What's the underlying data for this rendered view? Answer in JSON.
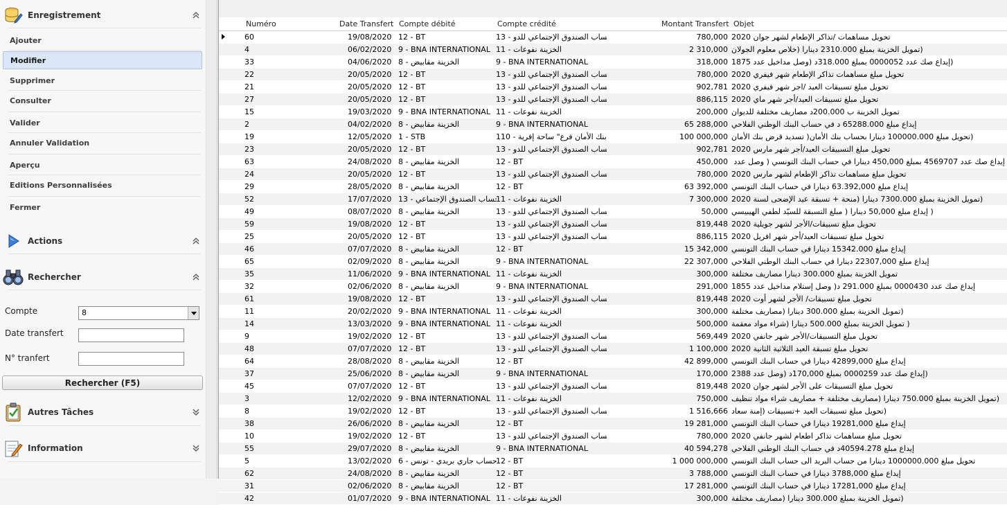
{
  "sidebar": {
    "enregistrement": {
      "title": "Enregistrement",
      "items": [
        "Ajouter",
        "Modifier",
        "Supprimer",
        "Consulter",
        "Valider",
        "Annuler Validation",
        "Aperçu",
        "Editions Personnalisées",
        "Fermer"
      ],
      "active": "Modifier"
    },
    "actions": {
      "title": "Actions"
    },
    "rechercher": {
      "title": "Rechercher",
      "compte_label": "Compte",
      "compte_value": "8",
      "date_label": "Date transfert",
      "date_value": "",
      "numero_label": "N° tranfert",
      "numero_value": "",
      "button_label": "Rechercher (F5)"
    },
    "autres_taches": {
      "title": "Autres Tâches"
    },
    "information": {
      "title": "Information"
    }
  },
  "grid": {
    "headers": {
      "numero": "Numéro",
      "date": "Date Transfert",
      "debite": "Compte débité",
      "credite": "Compte crédité",
      "montant": "Montant Transfert",
      "objet": "Objet"
    },
    "rows": [
      {
        "numero": "60",
        "date": "19/08/2020",
        "debite": "12 - BT",
        "credite": "13 - حساب الصندوق الإجتماعي للدو",
        "montant": "780,000",
        "objet": "تحويل مساهمات /تذاكر الإطعام لشهر جوان 2020"
      },
      {
        "numero": "4",
        "date": "06/02/2020",
        "debite": "9 - BNA INTERNATIONAL",
        "credite": "11 - الخزينة نفوعات",
        "montant": "2 310,000",
        "objet": "(تمويل الخزينة بمبلغ 2310.000 دينارا (خلاص معلوم الجولان"
      },
      {
        "numero": "33",
        "date": "04/06/2020",
        "debite": "8 - الخزينة مقابيض",
        "credite": "9 - BNA INTERNATIONAL",
        "montant": "318,000",
        "objet": "(إيداع صك عدد 0000052 بمبلغ 318.000د (وصل مداخيل عدد 1875"
      },
      {
        "numero": "22",
        "date": "20/05/2020",
        "debite": "12 - BT",
        "credite": "13 - حساب الصندوق الإجتماعي للدو",
        "montant": "780,000",
        "objet": "تحويل مبلغ مساهمات تذاكر الإطعام شهر فيفري 2020"
      },
      {
        "numero": "21",
        "date": "20/05/2020",
        "debite": "12 - BT",
        "credite": "13 - حساب الصندوق الإجتماعي للدو",
        "montant": "902,781",
        "objet": "تحويل مبلغ تسبيقات العيد /اجر شهر فيفري 2020"
      },
      {
        "numero": "27",
        "date": "20/05/2020",
        "debite": "12 - BT",
        "credite": "13 - حساب الصندوق الإجتماعي للدو",
        "montant": "886,115",
        "objet": "تحويل مبلغ تسبيقات العيد/أجر شهر ماي 2020"
      },
      {
        "numero": "15",
        "date": "19/03/2020",
        "debite": "9 - BNA INTERNATIONAL",
        "credite": "11 - الخزينة نفوعات",
        "montant": "200,000",
        "objet": "تمويل الخزينة ب 200.000د مصاريف مختلفة للديوان"
      },
      {
        "numero": "2",
        "date": "04/02/2020",
        "debite": "8 - الخزينة مقابيض",
        "credite": "9 - BNA INTERNATIONAL",
        "montant": "65 288,000",
        "objet": "إيداع مبلغ 65288.000 د في حساب البنك الوطني الفلاحي"
      },
      {
        "numero": "19",
        "date": "12/05/2020",
        "debite": "1 - STB",
        "credite": "110 - بنك الأمان فرع\" ساحة إفرية",
        "montant": "100 000,000",
        "objet": "(تحويل مبلغ 100000.000 دينارا بحساب بنك الأمان( تسديد قرض بنك الأمان"
      },
      {
        "numero": "23",
        "date": "20/05/2020",
        "debite": "12 - BT",
        "credite": "13 - حساب الصندوق الإجتماعي للدو",
        "montant": "902,781",
        "objet": "تحويل مبلغ التسبيقات العيد/أجر شهر مارس 2020"
      },
      {
        "numero": "63",
        "date": "24/08/2020",
        "debite": "8 - الخزينة مقابيض",
        "credite": "12 - BT",
        "montant": "450,000",
        "objet": "إيداع صك عدد 4569707 بمبلغ 450,000 دينارا في حساب البنك التونسي ( وصل عدد 3986"
      },
      {
        "numero": "24",
        "date": "20/05/2020",
        "debite": "12 - BT",
        "credite": "13 - حساب الصندوق الإجتماعي للدو",
        "montant": "780,000",
        "objet": "تحويل مبلغ مساهمات تذاكر الإطعام لشهر مارس 2020"
      },
      {
        "numero": "29",
        "date": "28/05/2020",
        "debite": "8 - الخزينة مقابيض",
        "credite": "12 - BT",
        "montant": "63 392,000",
        "objet": "إيداع مبلغ 63.392,000 دينارا في حساب البنك التونسي"
      },
      {
        "numero": "52",
        "date": "17/07/2020",
        "debite": "13 - حساب الصندوق الإجتماعي",
        "credite": "11 - الخزينة نفوعات",
        "montant": "7 300,000",
        "objet": "(تمويل الخزينة بمبلغ 7300.000 دينارا (منحة + تسبقة عيد الإضحى لسنة 2020"
      },
      {
        "numero": "49",
        "date": "08/07/2020",
        "debite": "8 - الخزينة مقابيض",
        "credite": "13 - حساب الصندوق الإجتماعي للدو",
        "montant": "50,000",
        "objet": "( إيداع مبلغ 50,000 دينارا ( مبلغ التسبقة للسيّد لطفي الهيبيسي"
      },
      {
        "numero": "59",
        "date": "19/08/2020",
        "debite": "12 - BT",
        "credite": "13 - حساب الصندوق الإجتماعي للدو",
        "montant": "819,448",
        "objet": "تحويل مبلغ تسبيقات/الأجر لشهر جويلية 2020"
      },
      {
        "numero": "25",
        "date": "20/05/2020",
        "debite": "12 - BT",
        "credite": "13 - حساب الصندوق الإجتماعي للدو",
        "montant": "886,115",
        "objet": "تحويل مبلغ تسبيقات العيد/أجر شهر افريل 2020"
      },
      {
        "numero": "46",
        "date": "07/07/2020",
        "debite": "8 - الخزينة مقابيض",
        "credite": "12 - BT",
        "montant": "15 342,000",
        "objet": "إيداع مبلغ 15342.000 دينارا في حساب البنك التونسي"
      },
      {
        "numero": "65",
        "date": "02/09/2020",
        "debite": "8 - الخزينة مقابيض",
        "credite": "9 - BNA INTERNATIONAL",
        "montant": "22 307,000",
        "objet": "إيداع مبلغ 22307,000 دينارا في حساب البنك الوطني الفلاحي"
      },
      {
        "numero": "35",
        "date": "11/06/2020",
        "debite": "9 - BNA INTERNATIONAL",
        "credite": "11 - الخزينة نفوعات",
        "montant": "300,000",
        "objet": "تمويل الخزينة بمبلغ 300.000 دينارا مصاريف مختلفة"
      },
      {
        "numero": "32",
        "date": "02/06/2020",
        "debite": "8 - الخزينة مقابيض",
        "credite": "9 - BNA INTERNATIONAL",
        "montant": "291,000",
        "objet": "إيداع صك عدد 0000430 بمبلغ 291.000 د( وصل إستلام مداخيل عدد 1855"
      },
      {
        "numero": "61",
        "date": "19/08/2020",
        "debite": "12 - BT",
        "credite": "13 - حساب الصندوق الإجتماعي للدو",
        "montant": "819,448",
        "objet": "تحويل مبلغ تسبيقات/ الأجر لشهر أوت 2020"
      },
      {
        "numero": "11",
        "date": "20/02/2020",
        "debite": "9 - BNA INTERNATIONAL",
        "credite": "11 - الخزينة نفوعات",
        "montant": "300,000",
        "objet": "(تمويل الخزينة بمبلغ 300.000 دينارا (مصاريف مختلفة"
      },
      {
        "numero": "14",
        "date": "13/03/2020",
        "debite": "9 - BNA INTERNATIONAL",
        "credite": "11 - الخزينة نفوعات",
        "montant": "500,000",
        "objet": "( تمويل الخزينة بمبلغ 500.000 دينارا (شراء مواد معقمة"
      },
      {
        "numero": "9",
        "date": "19/02/2020",
        "debite": "12 - BT",
        "credite": "13 - حساب الصندوق الإجتماعي للدو",
        "montant": "569,449",
        "objet": "تحويل مبلغ التسبيقات/الأجر شهر جانفي 2020"
      },
      {
        "numero": "48",
        "date": "07/07/2020",
        "debite": "12 - BT",
        "credite": "13 - حساب الصندوق الإجتماعي للدو",
        "montant": "1 100,000",
        "objet": "تحويل مبلغ تسبقة العيد الثلاثية الثانية 2020"
      },
      {
        "numero": "64",
        "date": "28/08/2020",
        "debite": "8 - الخزينة مقابيض",
        "credite": "12 - BT",
        "montant": "42 899,000",
        "objet": "إيداع مبلغ 42899,000 دينارا في حساب البنك التونسي"
      },
      {
        "numero": "37",
        "date": "25/06/2020",
        "debite": "8 - الخزينة مقابيض",
        "credite": "9 - BNA INTERNATIONAL",
        "montant": "170,000",
        "objet": "(إيداع صك عدد 0000259 بمبلغ 170,000د (وصل عدد 2388"
      },
      {
        "numero": "45",
        "date": "07/07/2020",
        "debite": "12 - BT",
        "credite": "13 - حساب الصندوق الإجتماعي للدو",
        "montant": "819,448",
        "objet": "تحويل مبلغ التسبيقات على الأجر لشهر جوان 2020"
      },
      {
        "numero": "3",
        "date": "12/02/2020",
        "debite": "9 - BNA INTERNATIONAL",
        "credite": "11 - الخزينة نفوعات",
        "montant": "750,000",
        "objet": "(تمويل الخزينة بمبلغ 750.000 دينارا (مصاريف مختلفة + مصاريف شراء مواد تنظيف"
      },
      {
        "numero": "8",
        "date": "19/02/2020",
        "debite": "12 - BT",
        "credite": "13 - حساب الصندوق الإجتماعي للدو",
        "montant": "1 516,666",
        "objet": "(تحويل مبلغ تسبيقات العيد +تسبيقات (إمنة سعاد"
      },
      {
        "numero": "38",
        "date": "26/06/2020",
        "debite": "8 - الخزينة مقابيض",
        "credite": "12 - BT",
        "montant": "19 281,000",
        "objet": "إيداع مبلغ 19281,000 دينارا في حساب البنك التونسي"
      },
      {
        "numero": "10",
        "date": "19/02/2020",
        "debite": "12 - BT",
        "credite": "13 - حساب الصندوق الإجتماعي للدو",
        "montant": "780,000",
        "objet": "تحويل مبلغ مساهمات تذاكر اطعام لشهر جانفي 2020"
      },
      {
        "numero": "55",
        "date": "29/07/2020",
        "debite": "8 - الخزينة مقابيض",
        "credite": "9 - BNA INTERNATIONAL",
        "montant": "40 594,278",
        "objet": "إيداع مبلغ 40594.278د في حساب البنك الوطني الفلاحي"
      },
      {
        "numero": "5",
        "date": "13/02/2020",
        "debite": "6 - حساب جاري بريدي - تونس",
        "credite": "12 - BT",
        "montant": "1 000 000,000",
        "objet": "تحويل مبلغ 1000000.000 دينارا من حساب البريد الى حساب البنك التونسي"
      },
      {
        "numero": "62",
        "date": "24/08/2020",
        "debite": "8 - الخزينة مقابيض",
        "credite": "12 - BT",
        "montant": "3 788,000",
        "objet": "إيداع مبلغ 3788,000 دينارا في حساب البنك التونسي"
      },
      {
        "numero": "31",
        "date": "02/06/2020",
        "debite": "8 - الخزينة مقابيض",
        "credite": "12 - BT",
        "montant": "17 281,000",
        "objet": "إيداع مبلغ 17281,000 دينارا في حساب البنك التونسي"
      },
      {
        "numero": "42",
        "date": "01/07/2020",
        "debite": "9 - BNA INTERNATIONAL",
        "credite": "11 - الخزينة نفوعات",
        "montant": "300,000",
        "objet": "(تمويل الخزينة بمبلغ 300.000 دينارا (مصاريف مختلفة"
      }
    ]
  }
}
